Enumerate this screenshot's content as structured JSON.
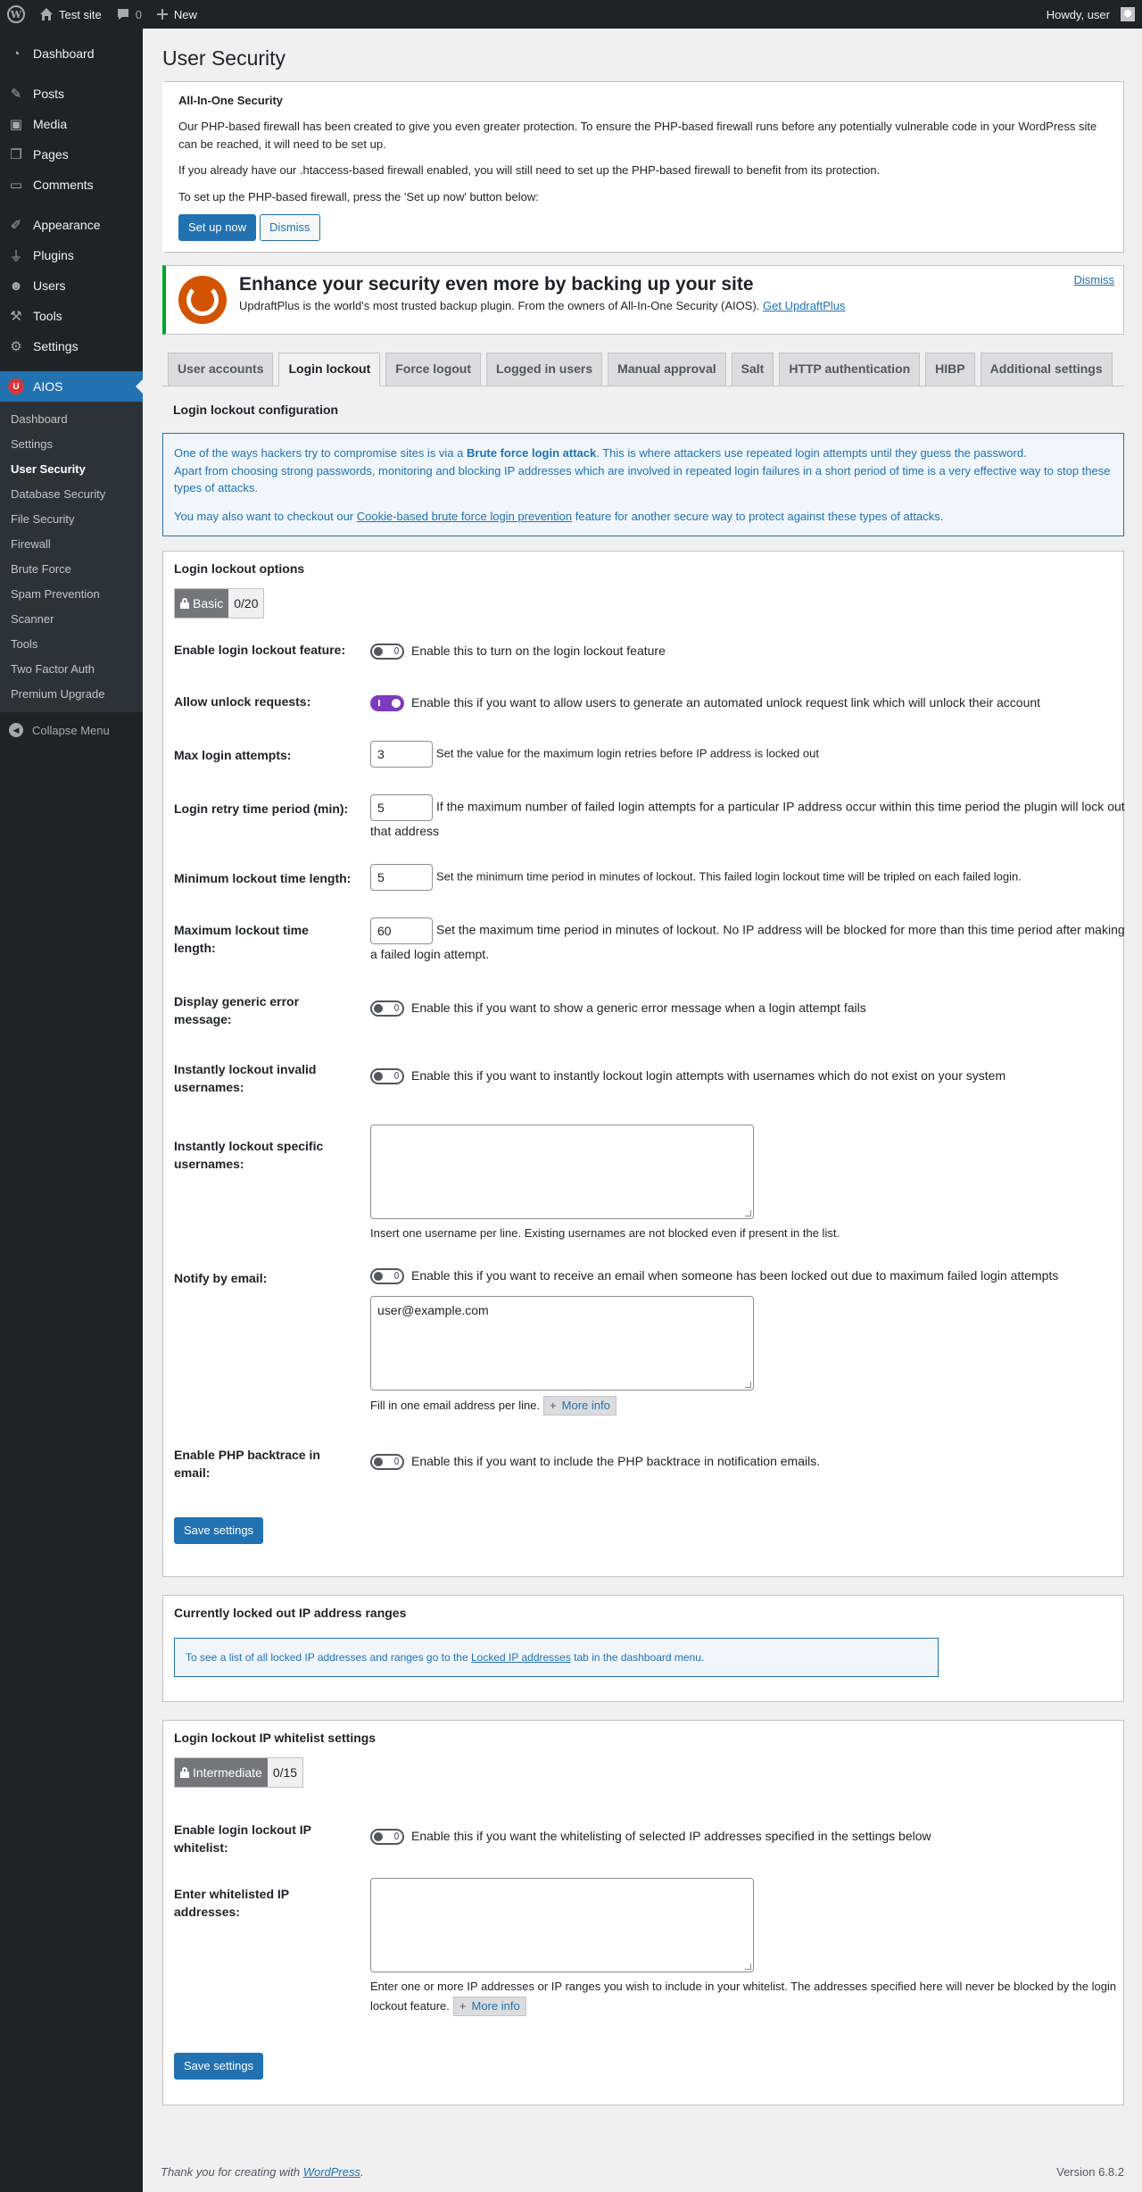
{
  "adminbar": {
    "site_name": "Test site",
    "comments_count": "0",
    "new_label": "New",
    "howdy": "Howdy, user"
  },
  "sidebar": {
    "items": [
      {
        "label": "Dashboard",
        "icon": "dashboard-icon"
      },
      {
        "label": "Posts",
        "icon": "pin-icon"
      },
      {
        "label": "Media",
        "icon": "media-icon"
      },
      {
        "label": "Pages",
        "icon": "pages-icon"
      },
      {
        "label": "Comments",
        "icon": "comment-icon"
      },
      {
        "label": "Appearance",
        "icon": "brush-icon"
      },
      {
        "label": "Plugins",
        "icon": "plug-icon"
      },
      {
        "label": "Users",
        "icon": "users-icon"
      },
      {
        "label": "Tools",
        "icon": "wrench-icon"
      },
      {
        "label": "Settings",
        "icon": "settings-icon"
      },
      {
        "label": "AIOS",
        "icon": "aios-shield-icon"
      }
    ],
    "submenu": [
      "Dashboard",
      "Settings",
      "User Security",
      "Database Security",
      "File Security",
      "Firewall",
      "Brute Force",
      "Spam Prevention",
      "Scanner",
      "Tools",
      "Two Factor Auth",
      "Premium Upgrade"
    ],
    "collapse_label": "Collapse Menu"
  },
  "page": {
    "title": "User Security"
  },
  "notice": {
    "heading": "All-In-One Security",
    "p1": "Our PHP-based firewall has been created to give you even greater protection. To ensure the PHP-based firewall runs before any potentially vulnerable code in your WordPress site can be reached, it will need to be set up.",
    "p2": "If you already have our .htaccess-based firewall enabled, you will still need to set up the PHP-based firewall to benefit from its protection.",
    "p3": "To set up the PHP-based firewall, press the 'Set up now' button below:",
    "setup_label": "Set up now",
    "dismiss_label": "Dismiss"
  },
  "updraft": {
    "heading": "Enhance your security even more by backing up your site",
    "text": "UpdraftPlus is the world's most trusted backup plugin. From the owners of All-In-One Security (AIOS).",
    "link": "Get UpdraftPlus",
    "dismiss": "Dismiss"
  },
  "tabs": [
    "User accounts",
    "Login lockout",
    "Force logout",
    "Logged in users",
    "Manual approval",
    "Salt",
    "HTTP authentication",
    "HIBP",
    "Additional settings"
  ],
  "active_tab": "Login lockout",
  "config": {
    "title": "Login lockout configuration",
    "info1_pre": "One of the ways hackers try to compromise sites is via a ",
    "info1_bold": "Brute force login attack",
    "info1_post": ". This is where attackers use repeated login attempts until they guess the password.",
    "info2": "Apart from choosing strong passwords, monitoring and blocking IP addresses which are involved in repeated login failures in a short period of time is a very effective way to stop these types of attacks.",
    "info3_pre": "You may also want to checkout our ",
    "info3_link": "Cookie-based brute force login prevention",
    "info3_post": " feature for another secure way to protect against these types of attacks."
  },
  "options": {
    "title": "Login lockout options",
    "badge_level": "Basic",
    "badge_score": "0/20",
    "fields": {
      "enable_label": "Enable login lockout feature:",
      "enable_desc": "Enable this to turn on the login lockout feature",
      "unlock_label": "Allow unlock requests:",
      "unlock_desc": "Enable this if you want to allow users to generate an automated unlock request link which will unlock their account",
      "max_attempts_label": "Max login attempts:",
      "max_attempts_value": "3",
      "max_attempts_desc": "Set the value for the maximum login retries before IP address is locked out",
      "retry_label": "Login retry time period (min):",
      "retry_value": "5",
      "retry_desc": "If the maximum number of failed login attempts for a particular IP address occur within this time period the plugin will lock out that address",
      "min_lock_label": "Minimum lockout time length:",
      "min_lock_value": "5",
      "min_lock_desc": "Set the minimum time period in minutes of lockout. This failed login lockout time will be tripled on each failed login.",
      "max_lock_label": "Maximum lockout time length:",
      "max_lock_value": "60",
      "max_lock_desc": "Set the maximum time period in minutes of lockout. No IP address will be blocked for more than this time period after making a failed login attempt.",
      "generic_label": "Display generic error message:",
      "generic_desc": "Enable this if you want to show a generic error message when a login attempt fails",
      "invalid_label": "Instantly lockout invalid usernames:",
      "invalid_desc": "Enable this if you want to instantly lockout login attempts with usernames which do not exist on your system",
      "specific_label": "Instantly lockout specific usernames:",
      "specific_value": "",
      "specific_hint": "Insert one username per line. Existing usernames are not blocked even if present in the list.",
      "notify_label": "Notify by email:",
      "notify_desc": "Enable this if you want to receive an email when someone has been locked out due to maximum failed login attempts",
      "notify_value": "user@example.com",
      "notify_hint": "Fill in one email address per line.",
      "more_info": "More info",
      "backtrace_label": "Enable PHP backtrace in email:",
      "backtrace_desc": "Enable this if you want to include the PHP backtrace in notification emails.",
      "save": "Save settings"
    }
  },
  "locked": {
    "title": "Currently locked out IP address ranges",
    "text_pre": "To see a list of all locked IP addresses and ranges go to the ",
    "link": "Locked IP addresses",
    "text_post": " tab in the dashboard menu."
  },
  "whitelist": {
    "title": "Login lockout IP whitelist settings",
    "badge_level": "Intermediate",
    "badge_score": "0/15",
    "enable_label": "Enable login lockout IP whitelist:",
    "enable_desc": "Enable this if you want the whitelisting of selected IP addresses specified in the settings below",
    "ip_label": "Enter whitelisted IP addresses:",
    "ip_value": "",
    "ip_hint": "Enter one or more IP addresses or IP ranges you wish to include in your whitelist. The addresses specified here will never be blocked by the login lockout feature.",
    "more_info": "More info",
    "save": "Save settings"
  },
  "footer": {
    "thanks_pre": "Thank you for creating with ",
    "thanks_link": "WordPress",
    "thanks_post": ".",
    "version": "Version 6.8.2"
  },
  "colors": {
    "accent": "#2271b1",
    "toggle_on": "#7e3bbf",
    "sidebar_bg": "#1d2327",
    "updraft_border": "#00a32a"
  }
}
